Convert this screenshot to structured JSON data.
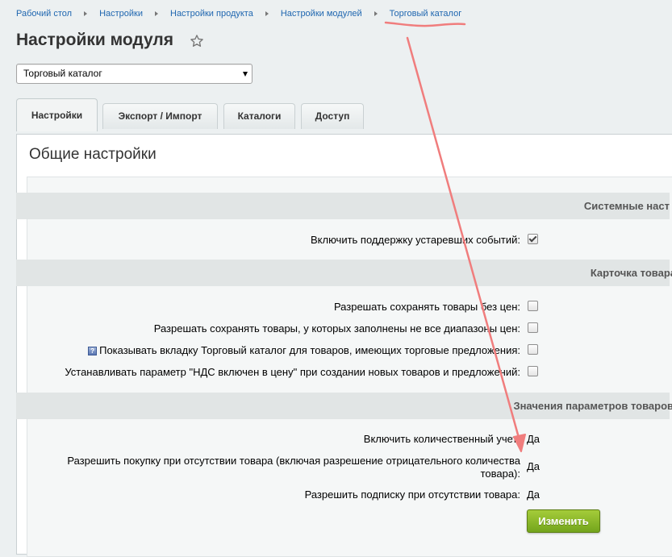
{
  "breadcrumb": [
    "Рабочий стол",
    "Настройки",
    "Настройки продукта",
    "Настройки модулей",
    "Торговый каталог"
  ],
  "page": {
    "title": "Настройки модуля"
  },
  "module_select": {
    "value": "Торговый каталог"
  },
  "tabs": [
    "Настройки",
    "Экспорт / Импорт",
    "Каталоги",
    "Доступ"
  ],
  "panel": {
    "title": "Общие настройки"
  },
  "sections": {
    "system": "Системные наст",
    "card": "Карточка товара",
    "params": "Значения параметров товаров"
  },
  "options": {
    "deprecated_events": "Включить поддержку устаревших событий:",
    "save_without_price": "Разрешать сохранять товары без цен:",
    "save_partial_ranges": "Разрешать сохранять товары, у которых заполнены не все диапазоны цен:",
    "show_catalog_tab": "Показывать вкладку Торговый каталог для товаров, имеющих торговые предложения:",
    "vat_included": "Устанавливать параметр \"НДС включен в цену\" при создании новых товаров и предложений:"
  },
  "params": {
    "quantity_label": "Включить количественный учет:",
    "quantity_value": "Да",
    "purchase_label_1": "Разрешить покупку при отсутствии товара (включая разрешение отрицательного количества",
    "purchase_label_2": "товара):",
    "purchase_value": "Да",
    "subscribe_label": "Разрешить подписку при отсутствии товара:",
    "subscribe_value": "Да"
  },
  "buttons": {
    "edit": "Изменить"
  },
  "help_glyph": "?",
  "icons": {
    "star": "star-icon",
    "help": "help-icon",
    "dropdown": "chevron-down-icon"
  },
  "colors": {
    "link": "#2067b0",
    "edit_button": "#8cb82c",
    "annotation": "#f07d7d"
  }
}
